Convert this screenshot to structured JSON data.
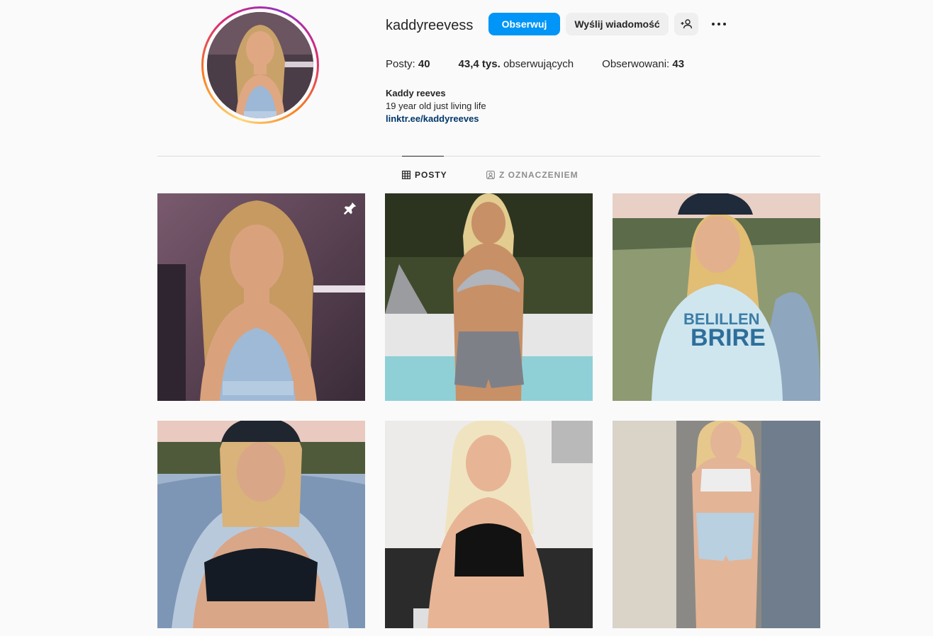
{
  "profile": {
    "username": "kaddyreevess",
    "follow_label": "Obserwuj",
    "message_label": "Wyślij wiadomość",
    "suggest_icon": "person-add-icon",
    "more_icon": "more-dots-icon"
  },
  "stats": {
    "posts_label": "Posty:",
    "posts_count": "40",
    "followers_count": "43,4 tys.",
    "followers_label": "obserwujących",
    "following_label": "Obserwowani:",
    "following_count": "43"
  },
  "bio": {
    "name": "Kaddy reeves",
    "text": "19 year old just living life",
    "link": "linktr.ee/kaddyreeves"
  },
  "tabs": {
    "posts": "POSTY",
    "tagged": "Z OZNACZENIEM",
    "posts_icon": "grid-icon",
    "tagged_icon": "tagged-person-icon"
  },
  "colors": {
    "accent": "#0095f6",
    "link": "#00376b",
    "background": "#fafafa"
  },
  "grid": {
    "pinned_icon": "pin-icon",
    "posts": [
      {
        "id": "post-1",
        "pinned": true
      },
      {
        "id": "post-2",
        "pinned": false
      },
      {
        "id": "post-3",
        "pinned": false
      },
      {
        "id": "post-4",
        "pinned": false
      },
      {
        "id": "post-5",
        "pinned": false
      },
      {
        "id": "post-6",
        "pinned": false
      }
    ]
  }
}
